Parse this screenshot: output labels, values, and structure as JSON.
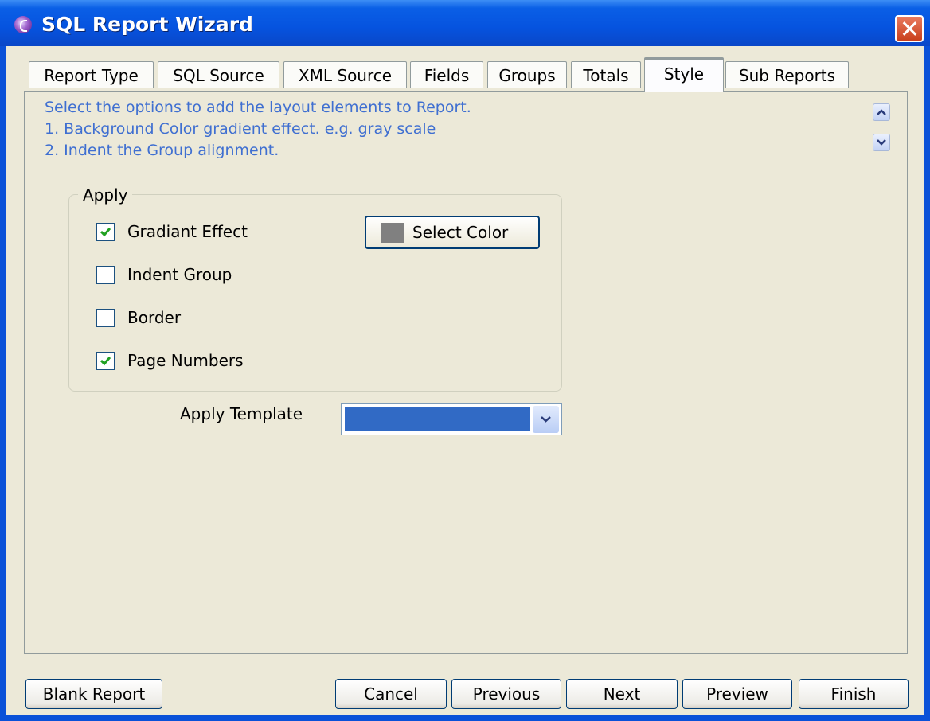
{
  "window": {
    "title": "SQL Report Wizard"
  },
  "tabs": [
    {
      "label": "Report Type"
    },
    {
      "label": "SQL Source"
    },
    {
      "label": "XML Source"
    },
    {
      "label": "Fields"
    },
    {
      "label": "Groups"
    },
    {
      "label": "Totals"
    },
    {
      "label": "Style",
      "active": true
    },
    {
      "label": "Sub Reports"
    }
  ],
  "info": {
    "line1": "Select the options to add the layout elements to Report.",
    "line2": "1. Background Color gradient effect. e.g. gray scale",
    "line3": "2. Indent the Group alignment."
  },
  "apply": {
    "legend": "Apply",
    "options": [
      {
        "label": "Gradiant Effect",
        "checked": true
      },
      {
        "label": "Indent Group",
        "checked": false
      },
      {
        "label": "Border",
        "checked": false
      },
      {
        "label": "Page Numbers",
        "checked": true
      }
    ],
    "select_color_label": "Select Color",
    "swatch_color": "#808080"
  },
  "template": {
    "label": "Apply Template",
    "value": ""
  },
  "buttons": {
    "blank_report": "Blank Report",
    "cancel": "Cancel",
    "previous": "Previous",
    "next": "Next",
    "preview": "Preview",
    "finish": "Finish"
  },
  "colors": {
    "title_bar": "#0653df",
    "info_text": "#3f6fd1",
    "check": "#21a121",
    "tab_highlight": "#ffc83c"
  }
}
